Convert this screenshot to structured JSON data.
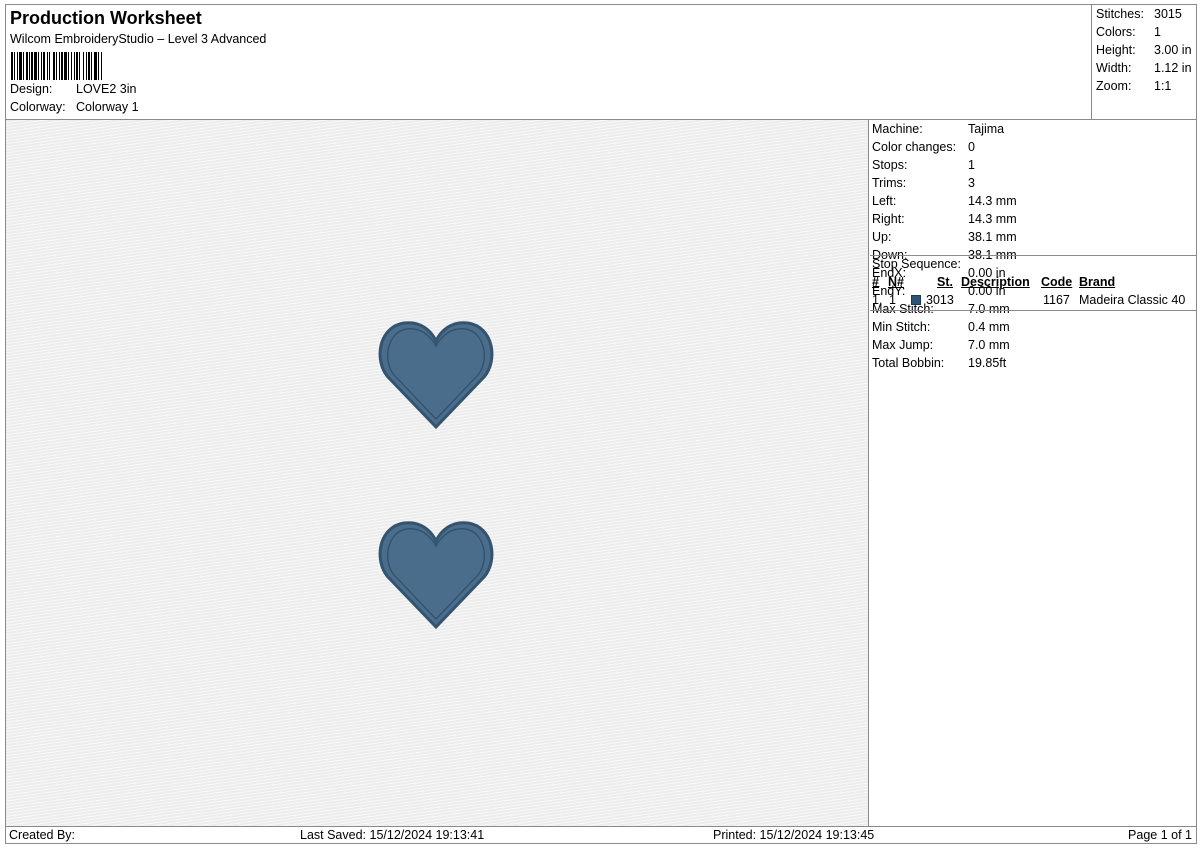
{
  "header": {
    "title": "Production Worksheet",
    "subtitle": "Wilcom EmbroideryStudio – Level 3 Advanced",
    "design_label": "Design:",
    "design_value": "LOVE2  3in",
    "colorway_label": "Colorway:",
    "colorway_value": "Colorway 1"
  },
  "summary": {
    "stitches_label": "Stitches:",
    "stitches_value": "3015",
    "colors_label": "Colors:",
    "colors_value": "1",
    "height_label": "Height:",
    "height_value": "3.00 in",
    "width_label": "Width:",
    "width_value": "1.12 in",
    "zoom_label": "Zoom:",
    "zoom_value": "1:1"
  },
  "details": [
    {
      "label": "Machine:",
      "value": "Tajima"
    },
    {
      "label": "Color changes:",
      "value": "0"
    },
    {
      "label": "Stops:",
      "value": "1"
    },
    {
      "label": "Trims:",
      "value": "3"
    },
    {
      "label": "Left:",
      "value": "14.3 mm"
    },
    {
      "label": "Right:",
      "value": "14.3 mm"
    },
    {
      "label": "Up:",
      "value": "38.1 mm"
    },
    {
      "label": "Down:",
      "value": "38.1 mm"
    },
    {
      "label": "EndX:",
      "value": "0.00 in"
    },
    {
      "label": "EndY:",
      "value": "0.00 in"
    },
    {
      "label": "Max Stitch:",
      "value": "7.0 mm"
    },
    {
      "label": "Min Stitch:",
      "value": "0.4 mm"
    },
    {
      "label": "Max Jump:",
      "value": "7.0 mm"
    },
    {
      "label": "Total Bobbin:",
      "value": "19.85ft"
    }
  ],
  "stop_sequence": {
    "title": "Stop Sequence:",
    "headers": {
      "num": "#",
      "n": "N#",
      "st": "St.",
      "description": "Description",
      "code": "Code",
      "brand": "Brand"
    },
    "rows": [
      {
        "num": "1.",
        "n": "1",
        "swatch_color": "#2d5478",
        "st": "3013",
        "description": "",
        "code": "1167",
        "brand": "Madeira Classic 40"
      }
    ]
  },
  "colors": {
    "heart_fill": "#4a6d8c",
    "heart_outline": "#34536f",
    "border": "#8a8a8a"
  },
  "footer": {
    "created_by": "Created By:",
    "last_saved": "Last Saved: 15/12/2024 19:13:41",
    "printed": "Printed: 15/12/2024 19:13:45",
    "page": "Page 1 of 1"
  }
}
